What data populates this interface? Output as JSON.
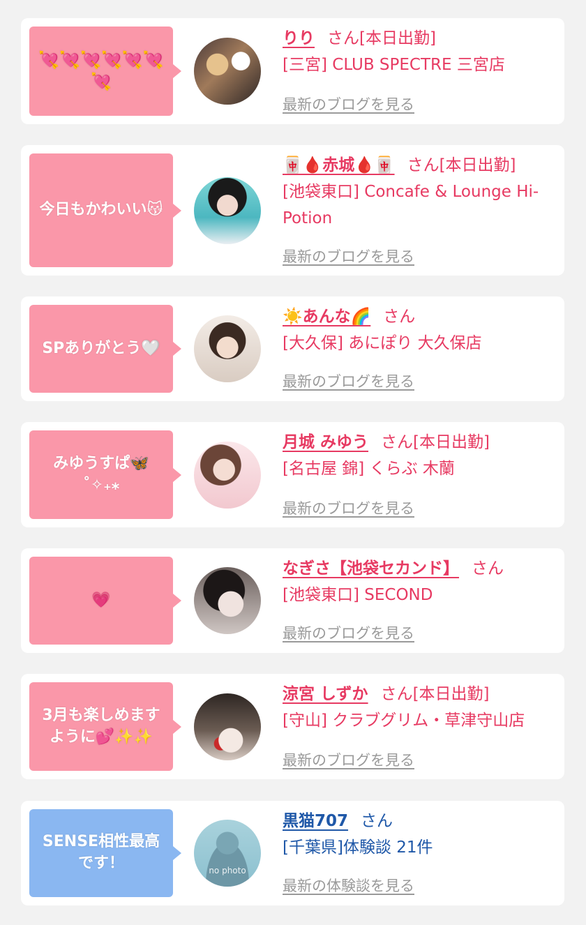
{
  "colors": {
    "pink_bubble": "#fa97a9",
    "blue_bubble": "#8ab7f1",
    "name_pink": "#e73a62",
    "name_blue": "#1f58a8",
    "link_gray": "#9a9a9a"
  },
  "cards": [
    {
      "bubble": "💘💘💘💘💘💘💘",
      "name": "りり",
      "suffix": "さん[本日出勤]",
      "shop": "[三宮] CLUB SPECTRE 三宮店",
      "link": "最新のブログを見る",
      "avatar_icon": "cast-photo"
    },
    {
      "bubble": "今日もかわいい😽",
      "name": "🀄🩸赤城🩸🀄",
      "suffix": "さん[本日出勤]",
      "shop": "[池袋東口] Concafe & Lounge Hi-Potion",
      "link": "最新のブログを見る",
      "avatar_icon": "cast-photo"
    },
    {
      "bubble": "SPありがとう🤍",
      "name": "☀️あんな🌈",
      "suffix": "さん",
      "shop": "[大久保] あにぽり 大久保店",
      "link": "最新のブログを見る",
      "avatar_icon": "cast-photo"
    },
    {
      "bubble": "みゆうすぱ🦋 ˚✧₊⁎",
      "name": "月城 みゆう",
      "suffix": "さん[本日出勤]",
      "shop": "[名古屋 錦] くらぶ 木蘭",
      "link": "最新のブログを見る",
      "avatar_icon": "cast-photo"
    },
    {
      "bubble": "💗",
      "name": "なぎさ【池袋セカンド】",
      "suffix": "さん",
      "shop": "[池袋東口] SECOND",
      "link": "最新のブログを見る",
      "avatar_icon": "cast-photo"
    },
    {
      "bubble": "3月も楽しめますように💕✨✨",
      "name": "涼宮 しずか",
      "suffix": "さん[本日出勤]",
      "shop": "[守山] クラブグリム・草津守山店",
      "link": "最新のブログを見る",
      "avatar_icon": "cast-photo"
    },
    {
      "bubble": "SENSE相性最高です！",
      "name": "黒猫707",
      "suffix": "さん",
      "shop": "[千葉県]体験談 21件",
      "link": "最新の体験談を見る",
      "avatar_icon": "no-photo-silhouette",
      "avatar_text": "no photo"
    }
  ]
}
